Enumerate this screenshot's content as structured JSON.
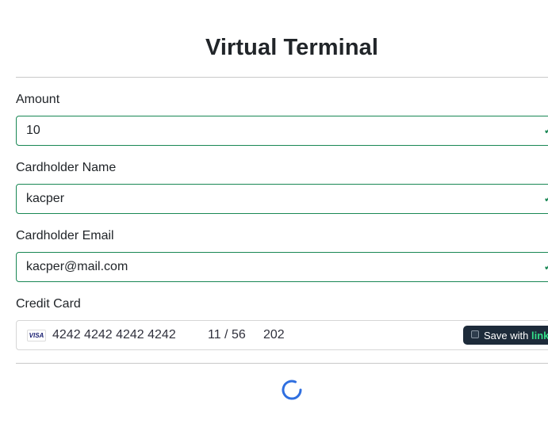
{
  "page": {
    "title": "Virtual Terminal"
  },
  "form": {
    "amount": {
      "label": "Amount",
      "value": "10"
    },
    "cardholder_name": {
      "label": "Cardholder Name",
      "value": "kacper"
    },
    "cardholder_email": {
      "label": "Cardholder Email",
      "value": "kacper@mail.com"
    },
    "credit_card": {
      "label": "Credit Card",
      "brand": "VISA",
      "number": "4242 4242 4242 4242",
      "expiry": "11 / 56",
      "cvc": "202",
      "link_save_text": "Save with ",
      "link_brand": "link"
    }
  },
  "icons": {
    "card_brand_icon": "visa-icon",
    "loading_icon": "spinner-icon",
    "valid_icon": "check-icon"
  },
  "colors": {
    "valid_border": "#198754",
    "link_pill_bg": "#1d2b3a",
    "link_brand": "#33dd88",
    "spinner": "#2f6fe0"
  }
}
